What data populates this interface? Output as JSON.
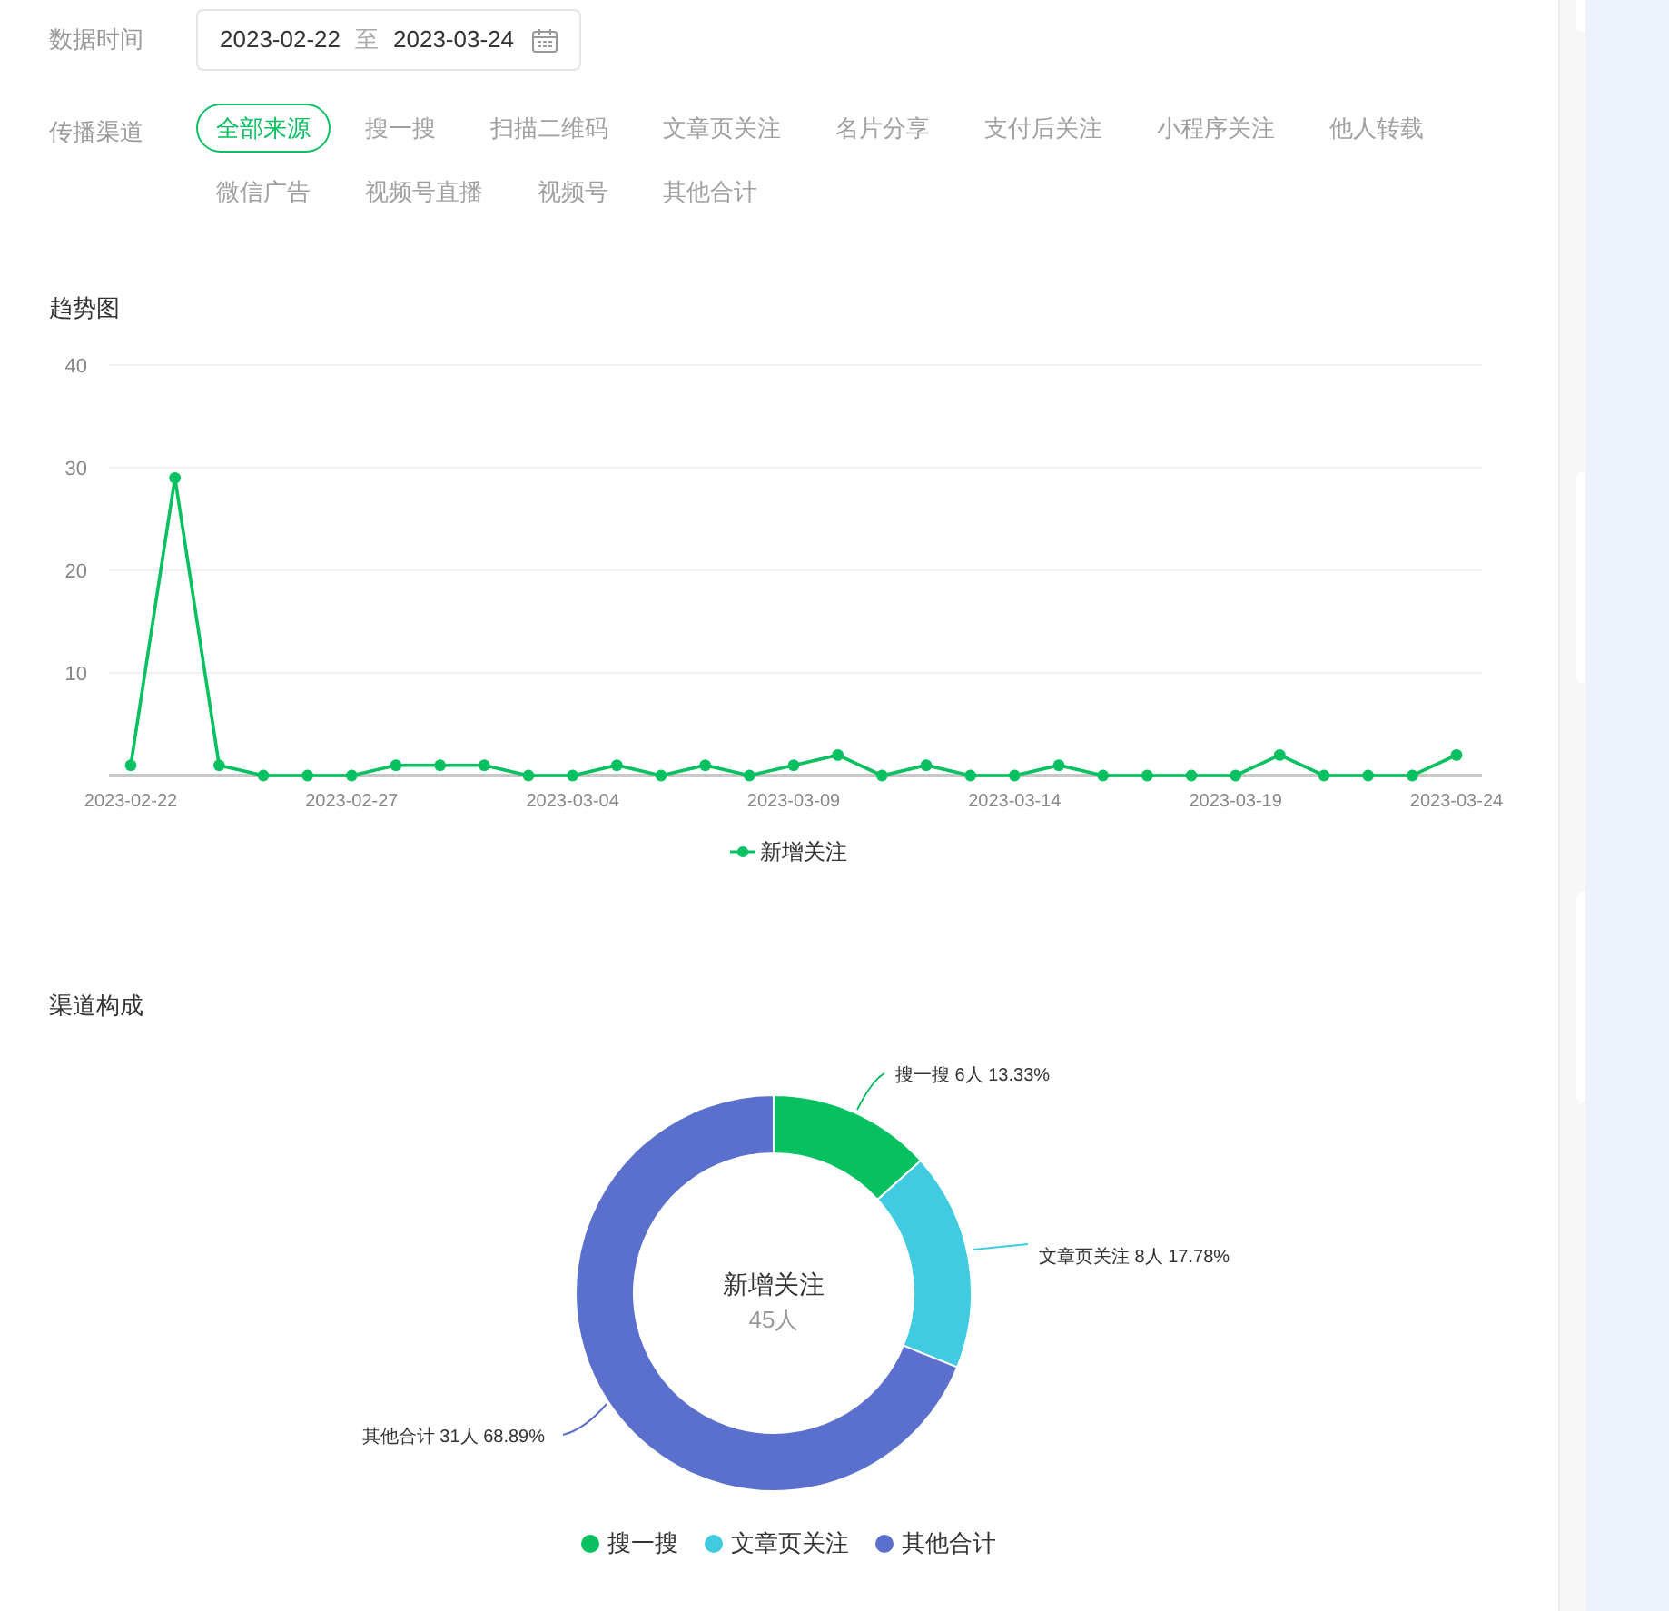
{
  "filters": {
    "date": {
      "label": "数据时间",
      "start": "2023-02-22",
      "separator": "至",
      "end": "2023-03-24"
    },
    "channel": {
      "label": "传播渠道",
      "options": [
        {
          "label": "全部来源",
          "selected": true
        },
        {
          "label": "搜一搜",
          "selected": false
        },
        {
          "label": "扫描二维码",
          "selected": false
        },
        {
          "label": "文章页关注",
          "selected": false
        },
        {
          "label": "名片分享",
          "selected": false
        },
        {
          "label": "支付后关注",
          "selected": false
        },
        {
          "label": "小程序关注",
          "selected": false
        },
        {
          "label": "他人转载",
          "selected": false
        },
        {
          "label": "微信广告",
          "selected": false
        },
        {
          "label": "视频号直播",
          "selected": false
        },
        {
          "label": "视频号",
          "selected": false
        },
        {
          "label": "其他合计",
          "selected": false
        }
      ]
    }
  },
  "trend": {
    "title": "趋势图",
    "chart_data": {
      "type": "line",
      "categories": [
        "2023-02-22",
        null,
        null,
        null,
        null,
        "2023-02-27",
        null,
        null,
        null,
        null,
        "2023-03-04",
        null,
        null,
        null,
        null,
        "2023-03-09",
        null,
        null,
        null,
        null,
        "2023-03-14",
        null,
        null,
        null,
        null,
        "2023-03-19",
        null,
        null,
        null,
        null,
        "2023-03-24"
      ],
      "series": [
        {
          "name": "新增关注",
          "color": "#07c160",
          "marker": "circle",
          "values": [
            1,
            29,
            1,
            0,
            0,
            0,
            1,
            1,
            1,
            0,
            0,
            1,
            0,
            1,
            0,
            1,
            2,
            0,
            1,
            0,
            0,
            1,
            0,
            0,
            0,
            0,
            2,
            0,
            0,
            0,
            2
          ]
        }
      ],
      "grid": true,
      "ylim": [
        0,
        40
      ],
      "yticks": [
        10,
        20,
        30,
        40
      ]
    }
  },
  "composition": {
    "title": "渠道构成",
    "center_value": "45人",
    "chart_data": {
      "type": "donut",
      "categories": [
        "搜一搜",
        "文章页关注",
        "其他合计"
      ],
      "series": [
        {
          "name": "新增关注",
          "values": [
            13.33,
            17.78,
            68.89
          ]
        }
      ],
      "value_labels": [
        "搜一搜 6人 13.33%",
        "文章页关注 8人 17.78%",
        "其他合计 31人 68.89%"
      ]
    },
    "legend": [
      {
        "color": "#07c160"
      },
      {
        "color": "#40cbe0"
      },
      {
        "color": "#5b70cc"
      }
    ]
  }
}
